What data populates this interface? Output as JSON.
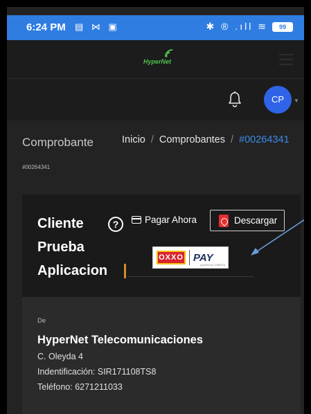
{
  "status_bar": {
    "time": "6:24 PM",
    "left_icons": "▤ ⋈ ▣",
    "right_icons": "✱ ® .ıll ≋",
    "battery": "99"
  },
  "app": {
    "logo_text": "HyperNet",
    "avatar_initials": "CP",
    "caret": "▼"
  },
  "breadcrumb": {
    "page_title": "Comprobante",
    "home": "Inicio",
    "sep1": "/",
    "section": "Comprobantes",
    "sep2": "/",
    "current": "#00264341"
  },
  "invoice": {
    "ref": "#00264341",
    "client_name": "Cliente Prueba Aplicacion",
    "help": "?",
    "pay_label": "Pagar Ahora",
    "download_label": "Descargar",
    "oxxo_logo": "OXXO",
    "oxxo_pay": "PAY",
    "oxxo_sub": "powered by CONEKTA"
  },
  "from": {
    "label": "De",
    "company": "HyperNet Telecomunicaciones",
    "address": "C. Oleyda 4",
    "id_line": "Indentificación: SIR171108TS8",
    "phone_line": "Teléfono: 6271211033"
  },
  "colors": {
    "accent": "#2f7de1",
    "avatar": "#2f64e8",
    "link": "#3d8ae8",
    "pdf": "#e42f2f",
    "progress": "#d68a2a"
  }
}
